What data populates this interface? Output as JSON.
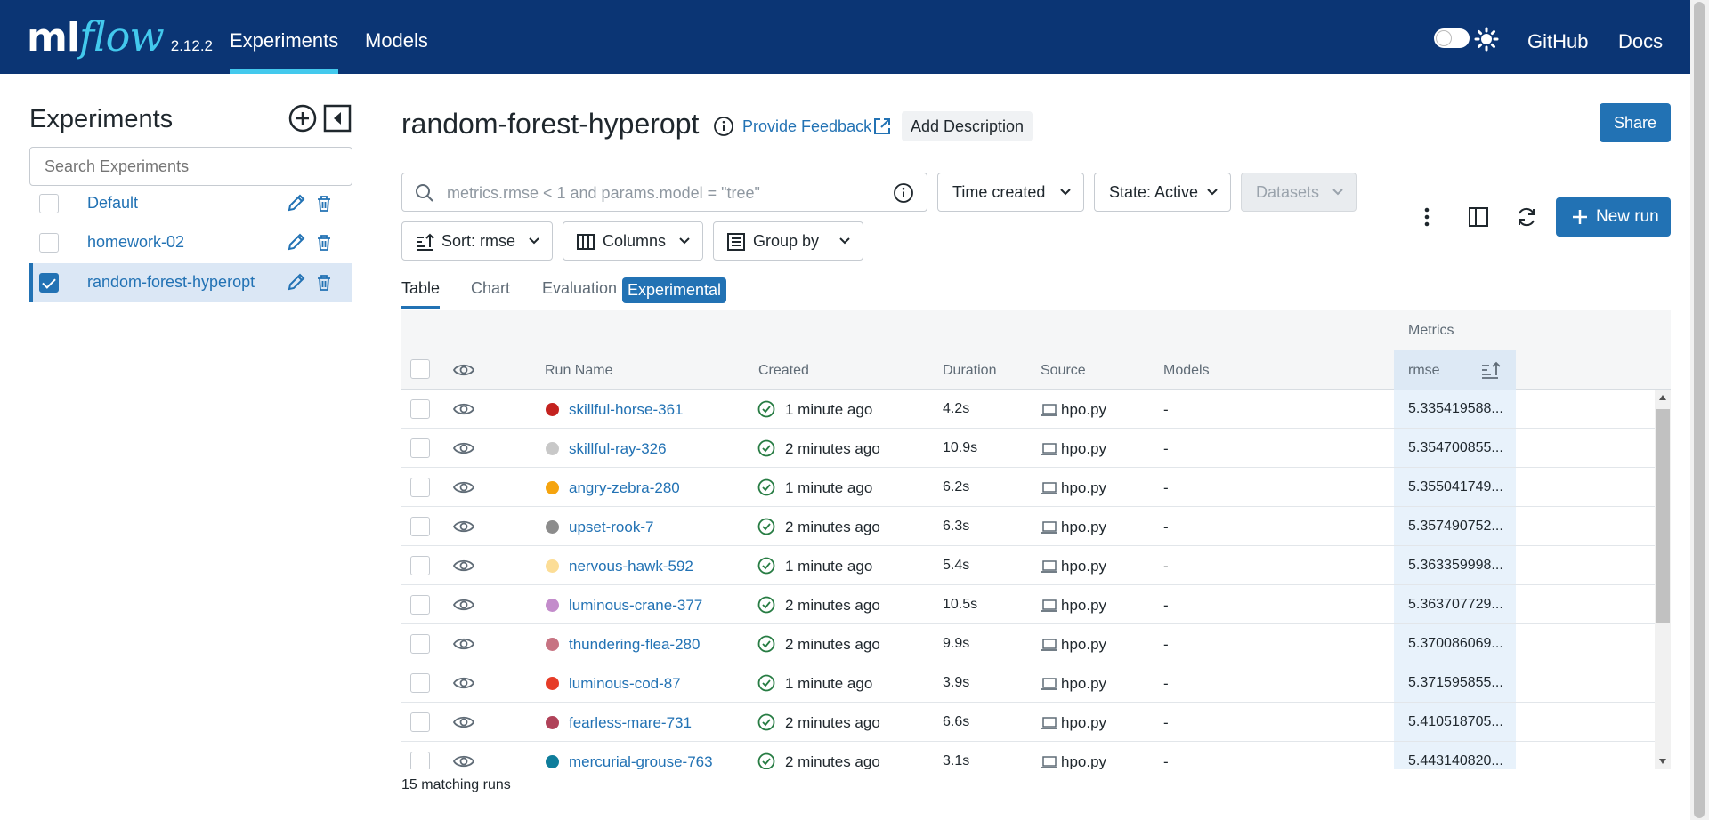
{
  "header": {
    "logo_ml": "ml",
    "logo_flow": "flow",
    "version": "2.12.2",
    "nav": [
      "Experiments",
      "Models"
    ],
    "links": [
      "GitHub",
      "Docs"
    ]
  },
  "sidebar": {
    "title": "Experiments",
    "search_placeholder": "Search Experiments",
    "items": [
      {
        "name": "Default",
        "checked": false
      },
      {
        "name": "homework-02",
        "checked": false
      },
      {
        "name": "random-forest-hyperopt",
        "checked": true
      }
    ]
  },
  "main": {
    "title": "random-forest-hyperopt",
    "feedback": "Provide Feedback",
    "add_description": "Add Description",
    "share": "Share",
    "filter_placeholder": "metrics.rmse < 1 and params.model = \"tree\"",
    "time_created": "Time created",
    "state": "State: Active",
    "datasets": "Datasets",
    "sort": "Sort: rmse",
    "columns": "Columns",
    "group_by": "Group by",
    "new_run": "New run",
    "tabs": [
      "Table",
      "Chart",
      "Evaluation"
    ],
    "experimental": "Experimental"
  },
  "table": {
    "group_header": "Metrics",
    "columns": [
      "Run Name",
      "Created",
      "Duration",
      "Source",
      "Models",
      "rmse"
    ],
    "rows": [
      {
        "name": "skillful-horse-361",
        "color": "#c4221f",
        "created": "1 minute ago",
        "duration": "4.2s",
        "source": "hpo.py",
        "models": "-",
        "rmse": "5.335419588..."
      },
      {
        "name": "skillful-ray-326",
        "color": "#c8c8c8",
        "created": "2 minutes ago",
        "duration": "10.9s",
        "source": "hpo.py",
        "models": "-",
        "rmse": "5.354700855..."
      },
      {
        "name": "angry-zebra-280",
        "color": "#f5a40f",
        "created": "1 minute ago",
        "duration": "6.2s",
        "source": "hpo.py",
        "models": "-",
        "rmse": "5.355041749..."
      },
      {
        "name": "upset-rook-7",
        "color": "#8c8c8c",
        "created": "2 minutes ago",
        "duration": "6.3s",
        "source": "hpo.py",
        "models": "-",
        "rmse": "5.357490752..."
      },
      {
        "name": "nervous-hawk-592",
        "color": "#fcdd96",
        "created": "1 minute ago",
        "duration": "5.4s",
        "source": "hpo.py",
        "models": "-",
        "rmse": "5.363359998..."
      },
      {
        "name": "luminous-crane-377",
        "color": "#c38ccb",
        "created": "2 minutes ago",
        "duration": "10.5s",
        "source": "hpo.py",
        "models": "-",
        "rmse": "5.363707729..."
      },
      {
        "name": "thundering-flea-280",
        "color": "#c77382",
        "created": "2 minutes ago",
        "duration": "9.9s",
        "source": "hpo.py",
        "models": "-",
        "rmse": "5.370086069..."
      },
      {
        "name": "luminous-cod-87",
        "color": "#e63c27",
        "created": "1 minute ago",
        "duration": "3.9s",
        "source": "hpo.py",
        "models": "-",
        "rmse": "5.371595855..."
      },
      {
        "name": "fearless-mare-731",
        "color": "#b04259",
        "created": "2 minutes ago",
        "duration": "6.6s",
        "source": "hpo.py",
        "models": "-",
        "rmse": "5.410518705..."
      },
      {
        "name": "mercurial-grouse-763",
        "color": "#0f7d9b",
        "created": "2 minutes ago",
        "duration": "3.1s",
        "source": "hpo.py",
        "models": "-",
        "rmse": "5.443140820..."
      }
    ],
    "matching_count": "15",
    "matching_label": "matching runs"
  },
  "colors": {
    "header_bg": "#0b3574",
    "accent": "#2272b4",
    "success": "#277c43"
  }
}
